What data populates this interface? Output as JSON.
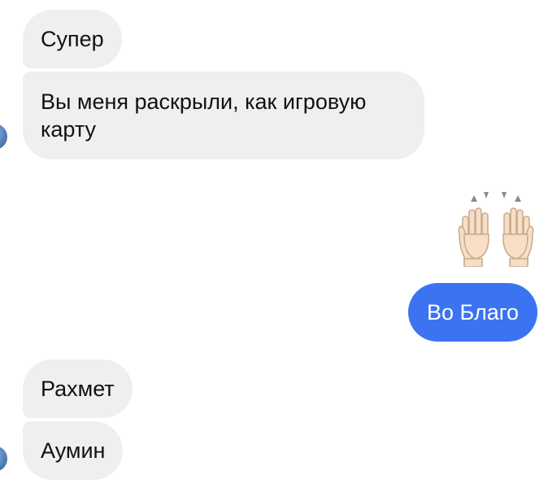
{
  "messages": [
    {
      "side": "incoming",
      "text": "Супер"
    },
    {
      "side": "incoming",
      "text": "Вы меня раскрыли, как игровую карту"
    },
    {
      "side": "outgoing",
      "emoji": "raising-hands"
    },
    {
      "side": "outgoing",
      "text": "Во Благо"
    },
    {
      "side": "incoming",
      "text": "Рахмет"
    },
    {
      "side": "incoming",
      "text": "Аумин"
    }
  ],
  "colors": {
    "incoming_bubble": "#efefef",
    "outgoing_bubble": "#3b73f1"
  }
}
